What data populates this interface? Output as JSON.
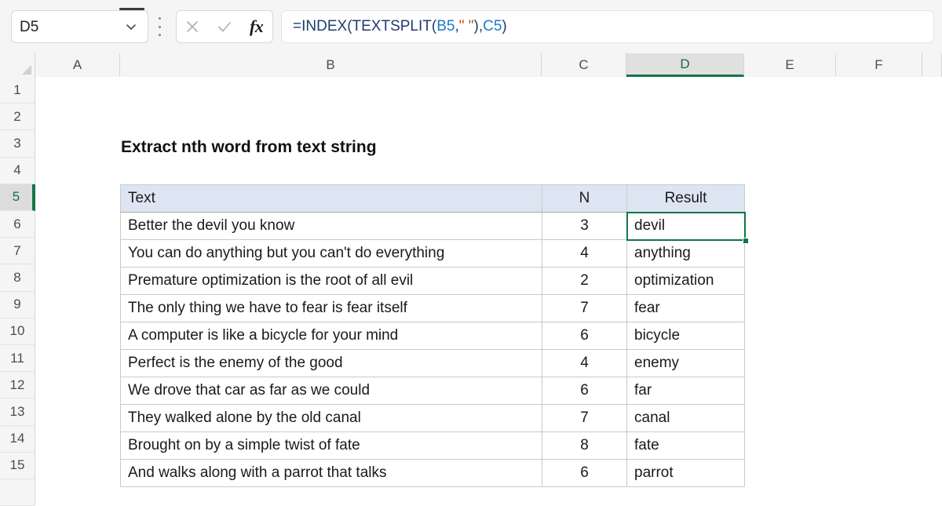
{
  "app": {
    "name_box_value": "D5",
    "name_box_icon": "chevron-down-icon",
    "kebab_icon": "more-options-icon",
    "cancel_icon": "close-x-icon",
    "confirm_icon": "checkmark-icon",
    "function_icon_label": "fx",
    "formula": "=INDEX(TEXTSPLIT(B5,\" \"),C5)",
    "formula_tokens": {
      "eq": "=",
      "fn1": "INDEX",
      "open1": "(",
      "fn2": "TEXTSPLIT",
      "open2": "(",
      "ref1": "B5",
      "comma1": ",",
      "str": "\" \"",
      "close2": ")",
      "comma2": ",",
      "ref2": "C5",
      "close1": ")"
    }
  },
  "grid": {
    "column_headers": [
      "A",
      "B",
      "C",
      "D",
      "E",
      "F"
    ],
    "selected_column": "D",
    "row_headers": [
      "1",
      "2",
      "3",
      "4",
      "5",
      "6",
      "7",
      "8",
      "9",
      "10",
      "11",
      "12",
      "13",
      "14",
      "15"
    ],
    "selected_row": "5",
    "active_cell": "D5"
  },
  "sheet": {
    "title": "Extract nth word from text string",
    "table": {
      "headers": [
        "Text",
        "N",
        "Result"
      ],
      "rows": [
        {
          "text": "Better the devil you know",
          "n": "3",
          "result": "devil"
        },
        {
          "text": "You can do anything but you can't do everything",
          "n": "4",
          "result": "anything"
        },
        {
          "text": "Premature optimization is the root of all evil",
          "n": "2",
          "result": "optimization"
        },
        {
          "text": "The only thing we have to fear is fear itself",
          "n": "7",
          "result": "fear"
        },
        {
          "text": "A computer is like a bicycle for your mind",
          "n": "6",
          "result": "bicycle"
        },
        {
          "text": "Perfect is the enemy of the good",
          "n": "4",
          "result": "enemy"
        },
        {
          "text": "We drove that car as far as we could",
          "n": "6",
          "result": "far"
        },
        {
          "text": "They walked alone by the old canal",
          "n": "7",
          "result": "canal"
        },
        {
          "text": "Brought on by a simple twist of fate",
          "n": "8",
          "result": "fate"
        },
        {
          "text": "And walks along with a parrot that talks",
          "n": "6",
          "result": "parrot"
        }
      ]
    }
  },
  "colors": {
    "selection_green": "#137547",
    "header_fill": "#dde5f2",
    "chrome_gray": "#f5f5f5",
    "formula_ref_blue": "#1d7ac4",
    "formula_string_orange": "#b8530a"
  }
}
